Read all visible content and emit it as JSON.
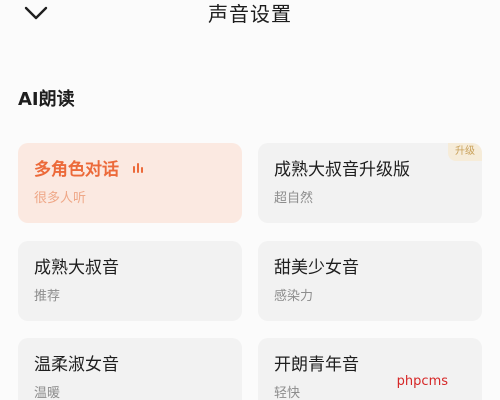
{
  "header": {
    "title": "声音设置",
    "back_icon": "chevron-down-icon"
  },
  "section": {
    "title": "AI朗读"
  },
  "colors": {
    "accent": "#ec6a3a",
    "selected_bg": "#fbe9e1",
    "card_bg": "#f2f2f2",
    "badge_text": "#c9a15a"
  },
  "voices": [
    {
      "name": "多角色对话",
      "subtitle": "很多人听",
      "selected": true,
      "indicator_icon": "playing-bars-icon"
    },
    {
      "name": "成熟大叔音升级版",
      "subtitle": "超自然",
      "badge": "升级"
    },
    {
      "name": "成熟大叔音",
      "subtitle": "推荐"
    },
    {
      "name": "甜美少女音",
      "subtitle": "感染力"
    },
    {
      "name": "温柔淑女音",
      "subtitle": "温暖"
    },
    {
      "name": "开朗青年音",
      "subtitle": "轻快"
    }
  ],
  "watermark": "phpcms"
}
